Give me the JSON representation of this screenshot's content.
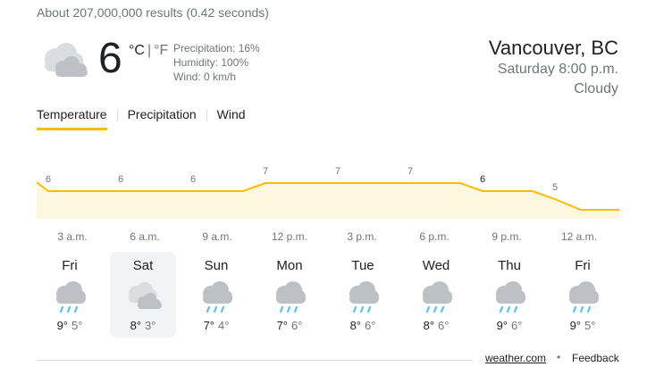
{
  "results_stats": "About 207,000,000 results (0.42 seconds)",
  "current": {
    "icon": "cloudy-icon",
    "temp": "6",
    "unit_c": "°C",
    "unit_sep": "|",
    "unit_f": "°F",
    "precipitation": "Precipitation: 16%",
    "humidity": "Humidity: 100%",
    "wind": "Wind: 0 km/h"
  },
  "location": {
    "city": "Vancouver, BC",
    "datetime": "Saturday 8:00 p.m.",
    "condition": "Cloudy"
  },
  "tabs": [
    {
      "label": "Temperature",
      "active": true
    },
    {
      "label": "Precipitation",
      "active": false
    },
    {
      "label": "Wind",
      "active": false
    }
  ],
  "chart_data": {
    "type": "area",
    "x": [
      "3 a.m.",
      "6 a.m.",
      "9 a.m.",
      "12 p.m.",
      "3 p.m.",
      "6 p.m.",
      "9 p.m.",
      "12 a.m."
    ],
    "values": [
      6,
      6,
      6,
      7,
      7,
      7,
      6,
      5
    ],
    "current_index": 6,
    "line_color": "#fbbc04",
    "fill_color": "#fef7e0"
  },
  "days": [
    {
      "name": "Fri",
      "icon": "rain-icon",
      "hi": "9°",
      "lo": "5°",
      "selected": false
    },
    {
      "name": "Sat",
      "icon": "cloudy-icon",
      "hi": "8°",
      "lo": "3°",
      "selected": true
    },
    {
      "name": "Sun",
      "icon": "rain-icon",
      "hi": "7°",
      "lo": "4°",
      "selected": false
    },
    {
      "name": "Mon",
      "icon": "rain-icon",
      "hi": "7°",
      "lo": "6°",
      "selected": false
    },
    {
      "name": "Tue",
      "icon": "rain-icon",
      "hi": "8°",
      "lo": "6°",
      "selected": false
    },
    {
      "name": "Wed",
      "icon": "rain-icon",
      "hi": "8°",
      "lo": "6°",
      "selected": false
    },
    {
      "name": "Thu",
      "icon": "rain-icon",
      "hi": "9°",
      "lo": "6°",
      "selected": false
    },
    {
      "name": "Fri",
      "icon": "rain-icon",
      "hi": "9°",
      "lo": "5°",
      "selected": false
    }
  ],
  "footer": {
    "source": "weather.com",
    "separator": "•",
    "feedback": "Feedback"
  }
}
